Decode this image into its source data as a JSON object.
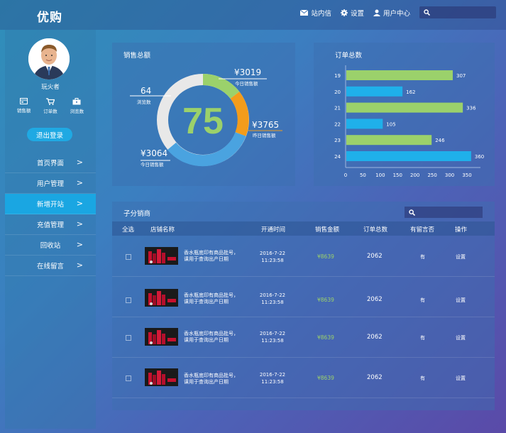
{
  "app": {
    "logo": "优购"
  },
  "topnav": {
    "messages": "站内信",
    "settings": "设置",
    "user_center": "用户中心",
    "search_placeholder": ""
  },
  "user": {
    "name": "玩火者"
  },
  "stats": [
    {
      "label": "销售额",
      "icon": "card-icon"
    },
    {
      "label": "订单数",
      "icon": "cart-icon"
    },
    {
      "label": "浏览数",
      "icon": "briefcase-icon"
    }
  ],
  "logout_label": "退出登录",
  "menu": [
    {
      "label": "首页界面",
      "active": false
    },
    {
      "label": "用户管理",
      "active": false
    },
    {
      "label": "新增开站",
      "active": true
    },
    {
      "label": "充值管理",
      "active": false
    },
    {
      "label": "回收站",
      "active": false
    },
    {
      "label": "在线留言",
      "active": false
    }
  ],
  "sales": {
    "title": "销售总额",
    "center_value": "75",
    "labels": {
      "top_right": {
        "value": "¥3019",
        "caption": "今日销售额"
      },
      "right": {
        "value": "¥3765",
        "caption": "昨日销售额"
      },
      "left_top": {
        "value": "64",
        "caption": "浏览数"
      },
      "left_bottom": {
        "value": "¥3064",
        "caption": "今日销售额"
      }
    },
    "colors": {
      "green": "#9bd16b",
      "orange": "#f39c1b",
      "blue": "#4aa3e0",
      "gray": "#e8e8e8"
    }
  },
  "orders": {
    "title": "订单总数",
    "chart_data": {
      "type": "bar",
      "orientation": "horizontal",
      "categories": [
        "19",
        "20",
        "21",
        "22",
        "23",
        "24"
      ],
      "values": [
        307,
        162,
        336,
        105,
        246,
        360
      ],
      "colors": [
        "#9bd16b",
        "#1fb0ea",
        "#9bd16b",
        "#1fb0ea",
        "#9bd16b",
        "#1fb0ea"
      ],
      "xticks": [
        "0",
        "50",
        "100",
        "150",
        "200",
        "250",
        "300",
        "350"
      ],
      "xlim": [
        0,
        350
      ]
    }
  },
  "subs": {
    "title": "子分销商",
    "search_placeholder": "",
    "headers": [
      "全选",
      "店铺名称",
      "开通时间",
      "销售金额",
      "订单总数",
      "有留言否",
      "操作"
    ],
    "rows": [
      {
        "desc_line1": "香水瓶底印有商品批号，",
        "desc_line2": "课用于查询出产日期",
        "date": "2016-7-22",
        "time": "11:23:58",
        "amount": "¥8639",
        "orders": "2062",
        "has_msg": "有",
        "action": "设置"
      },
      {
        "desc_line1": "香水瓶底印有商品批号，",
        "desc_line2": "课用于查询出产日期",
        "date": "2016-7-22",
        "time": "11:23:58",
        "amount": "¥8639",
        "orders": "2062",
        "has_msg": "有",
        "action": "设置"
      },
      {
        "desc_line1": "香水瓶底印有商品批号，",
        "desc_line2": "课用于查询出产日期",
        "date": "2016-7-22",
        "time": "11:23:58",
        "amount": "¥8639",
        "orders": "2062",
        "has_msg": "有",
        "action": "设置"
      },
      {
        "desc_line1": "香水瓶底印有商品批号，",
        "desc_line2": "课用于查询出产日期",
        "date": "2016-7-22",
        "time": "11:23:58",
        "amount": "¥8639",
        "orders": "2062",
        "has_msg": "有",
        "action": "设置"
      }
    ]
  }
}
